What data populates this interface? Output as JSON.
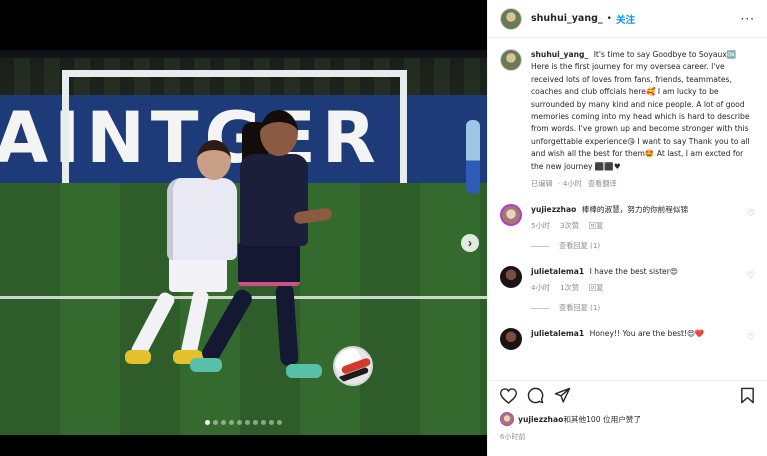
{
  "header": {
    "username": "shuhui_yang_",
    "separator": "•",
    "follow_label": "关注",
    "more_label": "···"
  },
  "media": {
    "board_text": "AINTGER",
    "next_label": "›",
    "dots_total": 10,
    "dot_active_index": 0
  },
  "caption": {
    "username": "shuhui_yang_",
    "text": "It's time to say Goodbye to Soyaux🆗 Here is the first journey for my oversea career. I've received lots of loves from fans, friends, teammates, coaches and club offcials here🥰 I am lucky to be surrounded by many kind and nice people. A lot of good memories coming into my head which is hard to describe from words. I've grown up and become stronger with this unforgettable experience😘 I want to say Thank you to all and wish all the best for them🤩 At last, I am excted for the new journey ⬛⬛♥",
    "edited_label": "已编辑",
    "sep": "·",
    "time": "4小时",
    "translate_label": "查看翻译"
  },
  "comments": [
    {
      "username": "yujiezzhao",
      "text": "棒棒的淑慧，努力的你前程似锦",
      "time": "5小时",
      "likes": "3次赞",
      "reply_label": "回复",
      "view_replies": "查看回复 (1)"
    },
    {
      "username": "julietalema1",
      "text": "I have the best sister😍",
      "time": "4小时",
      "likes": "1次赞",
      "reply_label": "回复",
      "view_replies": "查看回复 (1)"
    },
    {
      "username": "julietalema1",
      "text": "Honey!! You are the best!😍❤️",
      "time": "",
      "likes": "",
      "reply_label": "",
      "view_replies": ""
    }
  ],
  "likes_line": {
    "user": "yujiezzhao",
    "rest": "和其他100 位用户赞了"
  },
  "post_time": "6小时前",
  "icons": {
    "heart": "heart-icon",
    "comment": "comment-icon",
    "share": "share-icon",
    "save": "bookmark-icon"
  }
}
